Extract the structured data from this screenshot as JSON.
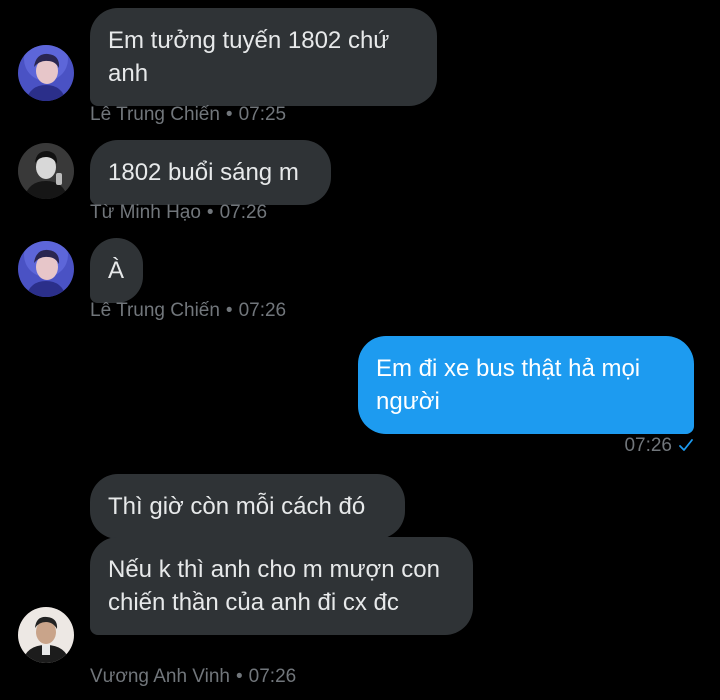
{
  "messages": [
    {
      "text": "Em tưởng tuyến 1802 chứ anh",
      "sender": "Lê Trung Chiến",
      "time": "07:25"
    },
    {
      "text": "1802 buổi sáng m",
      "sender": "Từ Minh Hạo",
      "time": "07:26"
    },
    {
      "text": "À",
      "sender": "Lê Trung Chiến",
      "time": "07:26"
    },
    {
      "text": "Em đi xe bus thật hả mọi người",
      "time": "07:26"
    },
    {
      "text": "Thì giờ còn mỗi cách đó"
    },
    {
      "text": "Nếu k thì anh cho m mượn con chiến thần của anh đi cx đc",
      "sender": "Vương Anh Vinh",
      "time": "07:26"
    }
  ],
  "separator": "•",
  "icons": {
    "read_receipt": "check-icon",
    "avatar_1": "avatar-le-trung-chien",
    "avatar_2": "avatar-tu-minh-hao",
    "avatar_3": "avatar-vuong-anh-vinh"
  },
  "colors": {
    "background": "#000000",
    "incoming_bubble": "#2f3336",
    "outgoing_bubble": "#1d9bf0",
    "meta_text": "#71767b",
    "check": "#1d9bf0"
  }
}
